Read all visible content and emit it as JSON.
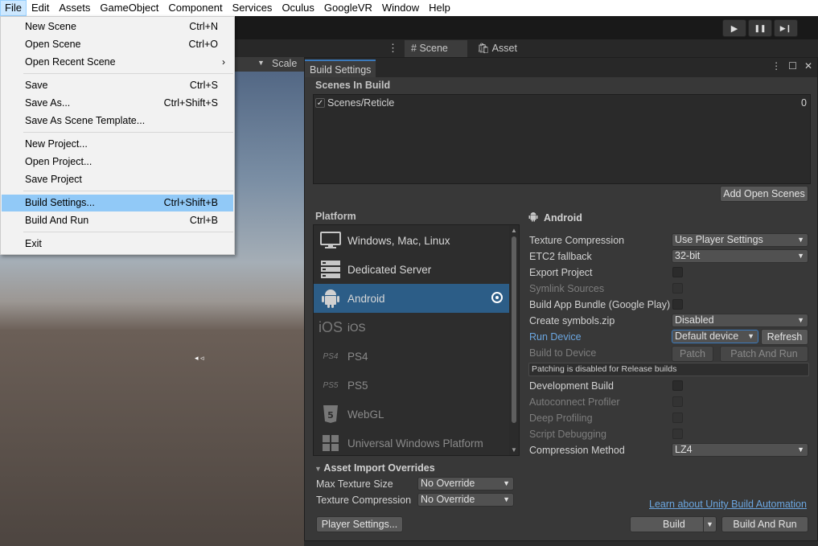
{
  "menubar": {
    "items": [
      "File",
      "Edit",
      "Assets",
      "GameObject",
      "Component",
      "Services",
      "Oculus",
      "GoogleVR",
      "Window",
      "Help"
    ],
    "active_index": 0
  },
  "toolbar": {
    "play_icon": "▶",
    "pause_icon": "❚❚",
    "step_icon": "▶❙"
  },
  "tabs": {
    "scene": "Scene",
    "asset_store": "Asset Store",
    "scale_label": "Scale"
  },
  "file_menu": {
    "items": [
      {
        "label": "New Scene",
        "shortcut": "Ctrl+N"
      },
      {
        "label": "Open Scene",
        "shortcut": "Ctrl+O"
      },
      {
        "label": "Open Recent Scene",
        "shortcut": "",
        "submenu": "›"
      },
      {
        "label": "Save",
        "shortcut": "Ctrl+S"
      },
      {
        "label": "Save As...",
        "shortcut": "Ctrl+Shift+S"
      },
      {
        "label": "Save As Scene Template...",
        "shortcut": ""
      },
      {
        "label": "New Project...",
        "shortcut": ""
      },
      {
        "label": "Open Project...",
        "shortcut": ""
      },
      {
        "label": "Save Project",
        "shortcut": ""
      },
      {
        "label": "Build Settings...",
        "shortcut": "Ctrl+Shift+B",
        "highlighted": true
      },
      {
        "label": "Build And Run",
        "shortcut": "Ctrl+B"
      },
      {
        "label": "Exit",
        "shortcut": ""
      }
    ]
  },
  "build_settings": {
    "title": "Build Settings",
    "scenes_in_build_label": "Scenes In Build",
    "scenes": [
      {
        "name": "Scenes/Reticle",
        "checked": true,
        "index": "0"
      }
    ],
    "add_open_scenes": "Add Open Scenes",
    "platform_label": "Platform",
    "platforms": [
      {
        "name": "Windows, Mac, Linux",
        "icon": "monitor-icon",
        "glyph": "🖥",
        "enabled": true
      },
      {
        "name": "Dedicated Server",
        "icon": "server-icon",
        "glyph": "▤",
        "enabled": true
      },
      {
        "name": "Android",
        "icon": "android-icon",
        "glyph": "🤖",
        "enabled": true,
        "selected": true
      },
      {
        "name": "iOS",
        "icon": "ios-icon",
        "glyph": "iOS",
        "enabled": false
      },
      {
        "name": "PS4",
        "icon": "ps4-icon",
        "glyph": "PS4",
        "enabled": false
      },
      {
        "name": "PS5",
        "icon": "ps5-icon",
        "glyph": "PS5",
        "enabled": false
      },
      {
        "name": "WebGL",
        "icon": "html5-icon",
        "glyph": "5",
        "enabled": false
      },
      {
        "name": "Universal Windows Platform",
        "icon": "windows-icon",
        "glyph": "⊞",
        "enabled": false
      }
    ],
    "selected_platform": "Android",
    "settings": {
      "texture_compression": {
        "label": "Texture Compression",
        "value": "Use Player Settings"
      },
      "etc2_fallback": {
        "label": "ETC2 fallback",
        "value": "32-bit"
      },
      "export_project": {
        "label": "Export Project"
      },
      "symlink_sources": {
        "label": "Symlink Sources"
      },
      "build_app_bundle": {
        "label": "Build App Bundle (Google Play)"
      },
      "create_symbols": {
        "label": "Create symbols.zip",
        "value": "Disabled"
      },
      "run_device": {
        "label": "Run Device",
        "value": "Default device",
        "refresh": "Refresh"
      },
      "build_to_device": {
        "label": "Build to Device",
        "patch": "Patch",
        "patch_and_run": "Patch And Run"
      },
      "patching_notice": "Patching is disabled for Release builds",
      "development_build": {
        "label": "Development Build"
      },
      "autoconnect_profiler": {
        "label": "Autoconnect Profiler"
      },
      "deep_profiling": {
        "label": "Deep Profiling"
      },
      "script_debugging": {
        "label": "Script Debugging"
      },
      "compression_method": {
        "label": "Compression Method",
        "value": "LZ4"
      }
    },
    "asset_import_overrides": {
      "label": "Asset Import Overrides",
      "max_texture_size": {
        "label": "Max Texture Size",
        "value": "No Override"
      },
      "texture_compression": {
        "label": "Texture Compression",
        "value": "No Override"
      }
    },
    "learn_link": "Learn about Unity Build Automation",
    "player_settings": "Player Settings...",
    "build": "Build",
    "build_and_run": "Build And Run"
  }
}
